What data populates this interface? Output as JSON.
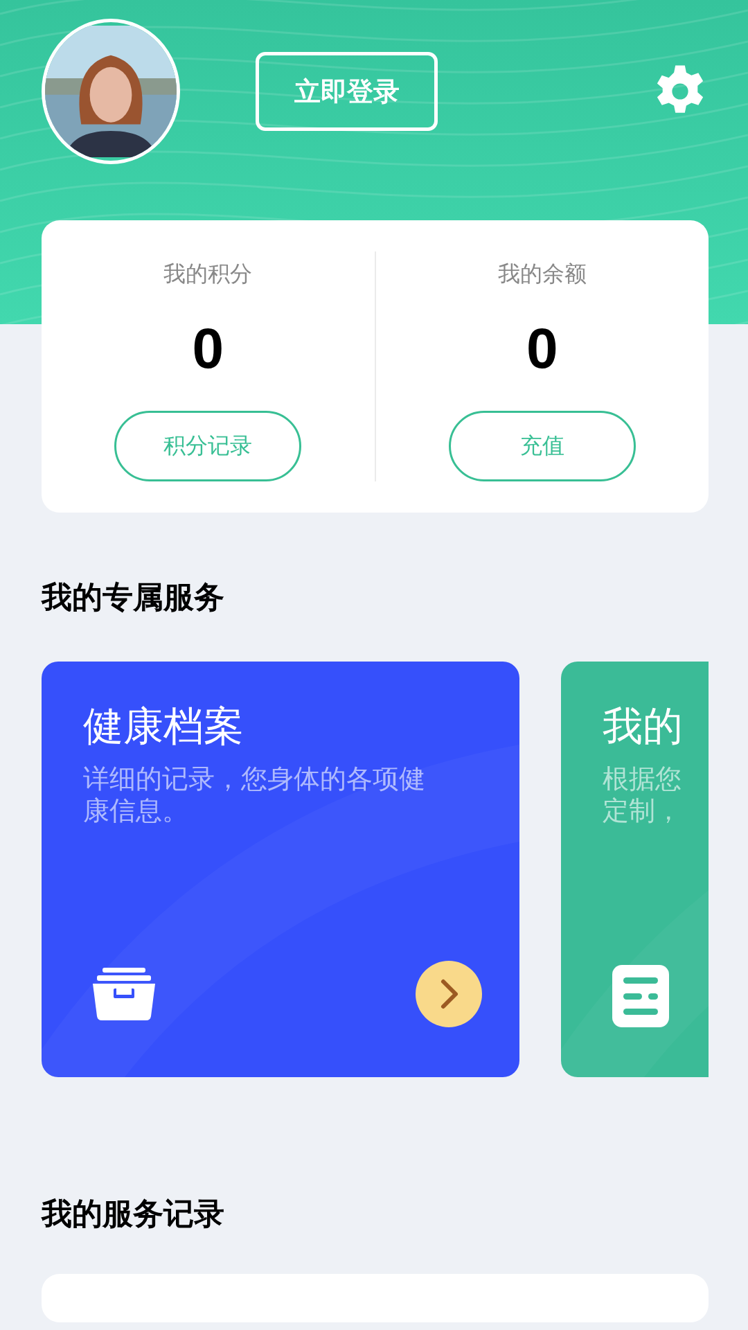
{
  "header": {
    "login_button": "立即登录"
  },
  "stats": [
    {
      "label": "我的积分",
      "value": "0",
      "button": "积分记录"
    },
    {
      "label": "我的余额",
      "value": "0",
      "button": "充值"
    }
  ],
  "services": {
    "title": "我的专属服务",
    "cards": [
      {
        "kind": "archive",
        "title": "健康档案",
        "desc_lines": [
          "详细的记录，您身体的各项健",
          "康信息。"
        ],
        "arrow": true,
        "color": "#3650fb"
      },
      {
        "kind": "document",
        "title": "我的",
        "desc_lines": [
          "根据您",
          "定制，"
        ],
        "arrow": false,
        "color": "#3bbb97"
      }
    ]
  },
  "records": {
    "title": "我的服务记录"
  }
}
